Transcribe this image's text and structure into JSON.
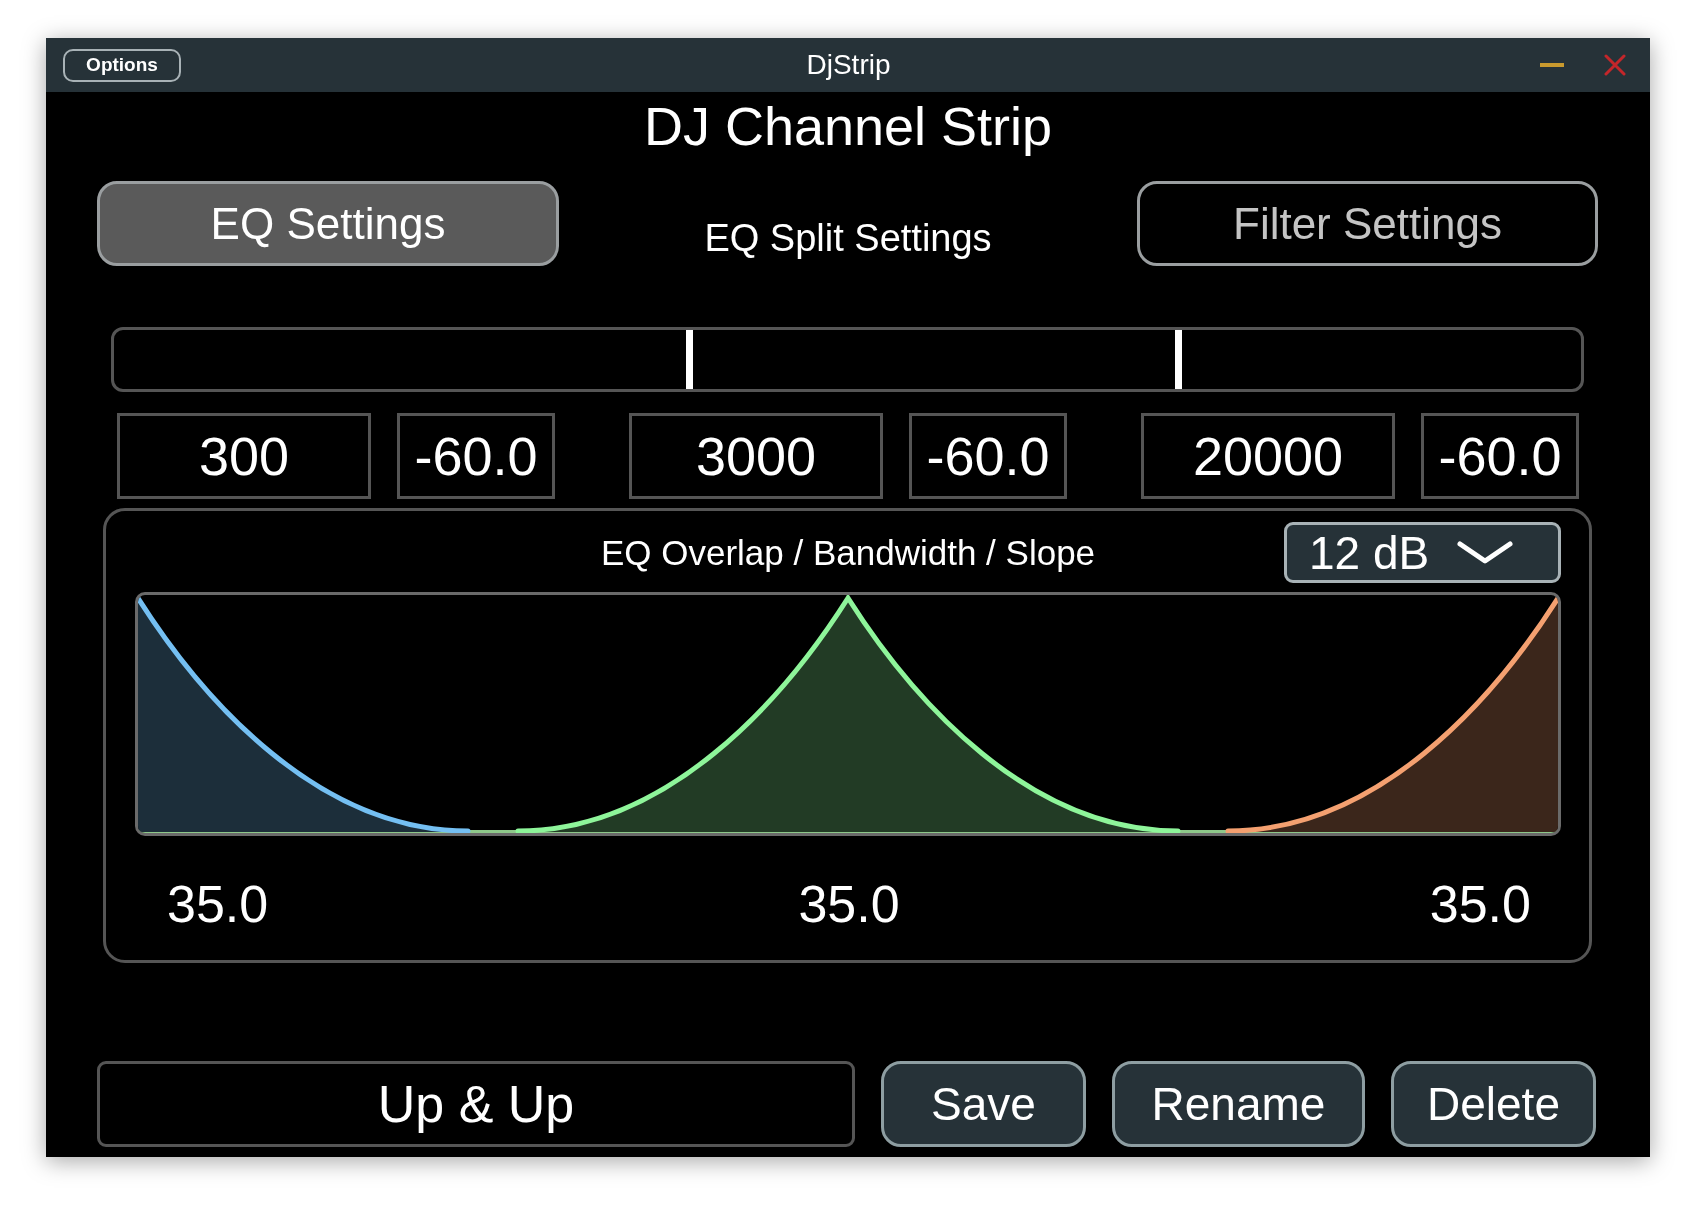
{
  "window": {
    "title": "DjStrip",
    "options_button": "Options"
  },
  "heading": "DJ Channel Strip",
  "tabs": [
    {
      "label": "EQ Settings",
      "selected": false,
      "highlighted": true
    },
    {
      "label": "EQ Split Settings",
      "selected": true,
      "highlighted": false
    },
    {
      "label": "Filter Settings",
      "selected": false,
      "highlighted": false
    }
  ],
  "split_slider": {
    "handles": [
      {
        "level": 0.392
      },
      {
        "level": 0.725
      }
    ]
  },
  "band_fields": [
    {
      "frequency": "300",
      "gain": "-60.0"
    },
    {
      "frequency": "3000",
      "gain": "-60.0"
    },
    {
      "frequency": "20000",
      "gain": "-60.0"
    }
  ],
  "overlap_panel": {
    "title": "EQ Overlap / Bandwidth / Slope",
    "slope": "12 dB",
    "bands": [
      {
        "color": "#74bff2",
        "value": "35.0"
      },
      {
        "color": "#8ef59a",
        "value": "35.0"
      },
      {
        "color": "#f4a070",
        "value": "35.0"
      }
    ]
  },
  "preset": {
    "name": "Up & Up",
    "buttons": [
      "Save",
      "Rename",
      "Delete"
    ]
  }
}
